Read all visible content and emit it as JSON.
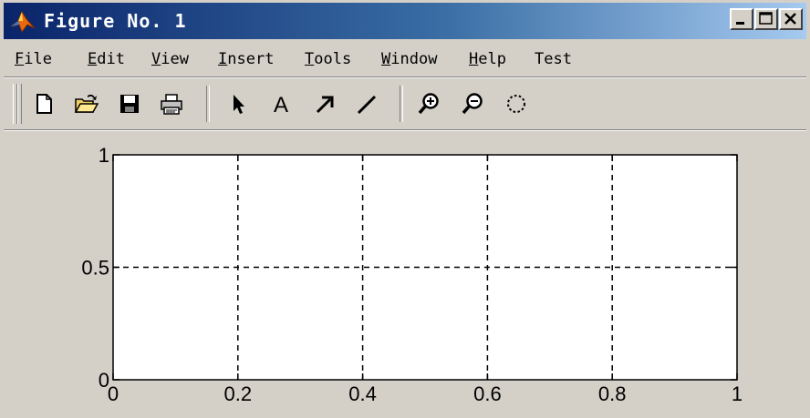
{
  "window": {
    "title": "Figure No. 1",
    "icon": "matlab-logo-icon",
    "controls": [
      "minimize-icon",
      "maximize-icon",
      "close-icon"
    ]
  },
  "menu": {
    "items": [
      {
        "label": "File",
        "mnemonic": "F"
      },
      {
        "label": "Edit",
        "mnemonic": "E"
      },
      {
        "label": "View",
        "mnemonic": "V"
      },
      {
        "label": "Insert",
        "mnemonic": "I"
      },
      {
        "label": "Tools",
        "mnemonic": "T"
      },
      {
        "label": "Window",
        "mnemonic": "W"
      },
      {
        "label": "Help",
        "mnemonic": "H"
      },
      {
        "label": "Test",
        "mnemonic": ""
      }
    ]
  },
  "toolbar": {
    "tools": [
      "new-file-icon",
      "open-folder-icon",
      "save-icon",
      "print-icon",
      "select-arrow-icon",
      "insert-text-icon",
      "insert-arrow-icon",
      "insert-line-icon",
      "zoom-in-icon",
      "zoom-out-icon",
      "rotate-3d-icon"
    ],
    "text_tool_glyph": "A"
  },
  "chart_data": {
    "type": "line",
    "title": "",
    "xlabel": "",
    "ylabel": "",
    "series": [],
    "xlim": [
      0,
      1
    ],
    "ylim": [
      0,
      1
    ],
    "xticks": [
      0,
      0.2,
      0.4,
      0.6,
      0.8,
      1
    ],
    "xtick_labels": [
      "0",
      "0.2",
      "0.4",
      "0.6",
      "0.8",
      "1"
    ],
    "yticks": [
      0,
      0.5,
      1
    ],
    "ytick_labels": [
      "0",
      "0.5",
      "1"
    ],
    "grid": true,
    "grid_style": "dashed",
    "colors": {
      "axes_background": "#ffffff",
      "figure_background": "#d4d0c8",
      "grid": "#000000"
    }
  }
}
